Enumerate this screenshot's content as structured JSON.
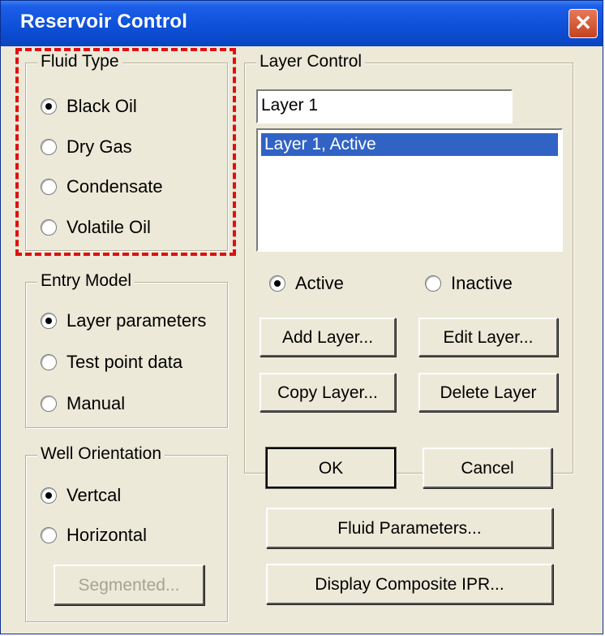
{
  "window": {
    "title": "Reservoir Control",
    "close_glyph": "✕"
  },
  "fluid_type": {
    "legend": "Fluid Type",
    "options": [
      {
        "label": "Black Oil",
        "selected": true
      },
      {
        "label": "Dry Gas",
        "selected": false
      },
      {
        "label": "Condensate",
        "selected": false
      },
      {
        "label": "Volatile Oil",
        "selected": false
      }
    ]
  },
  "entry_model": {
    "legend": "Entry Model",
    "options": [
      {
        "label": "Layer parameters",
        "selected": true
      },
      {
        "label": "Test point data",
        "selected": false
      },
      {
        "label": "Manual",
        "selected": false
      }
    ]
  },
  "well_orientation": {
    "legend": "Well Orientation",
    "options": [
      {
        "label": "Vertcal",
        "selected": true
      },
      {
        "label": "Horizontal",
        "selected": false
      }
    ],
    "segmented_label": "Segmented..."
  },
  "layer_control": {
    "legend": "Layer Control",
    "name_value": "Layer 1",
    "list_items": [
      "Layer 1, Active"
    ],
    "active_label": "Active",
    "inactive_label": "Inactive",
    "active_selected": true,
    "add_label": "Add Layer...",
    "edit_label": "Edit Layer...",
    "copy_label": "Copy Layer...",
    "delete_label": "Delete Layer"
  },
  "buttons": {
    "ok_label": "OK",
    "cancel_label": "Cancel",
    "fluid_params_label": "Fluid Parameters...",
    "composite_ipr_label": "Display Composite IPR..."
  },
  "colors": {
    "title_bar": "#0d4fd6",
    "dialog_bg": "#ece9d8",
    "selection": "#3163c5",
    "highlight_box": "#e01010"
  }
}
